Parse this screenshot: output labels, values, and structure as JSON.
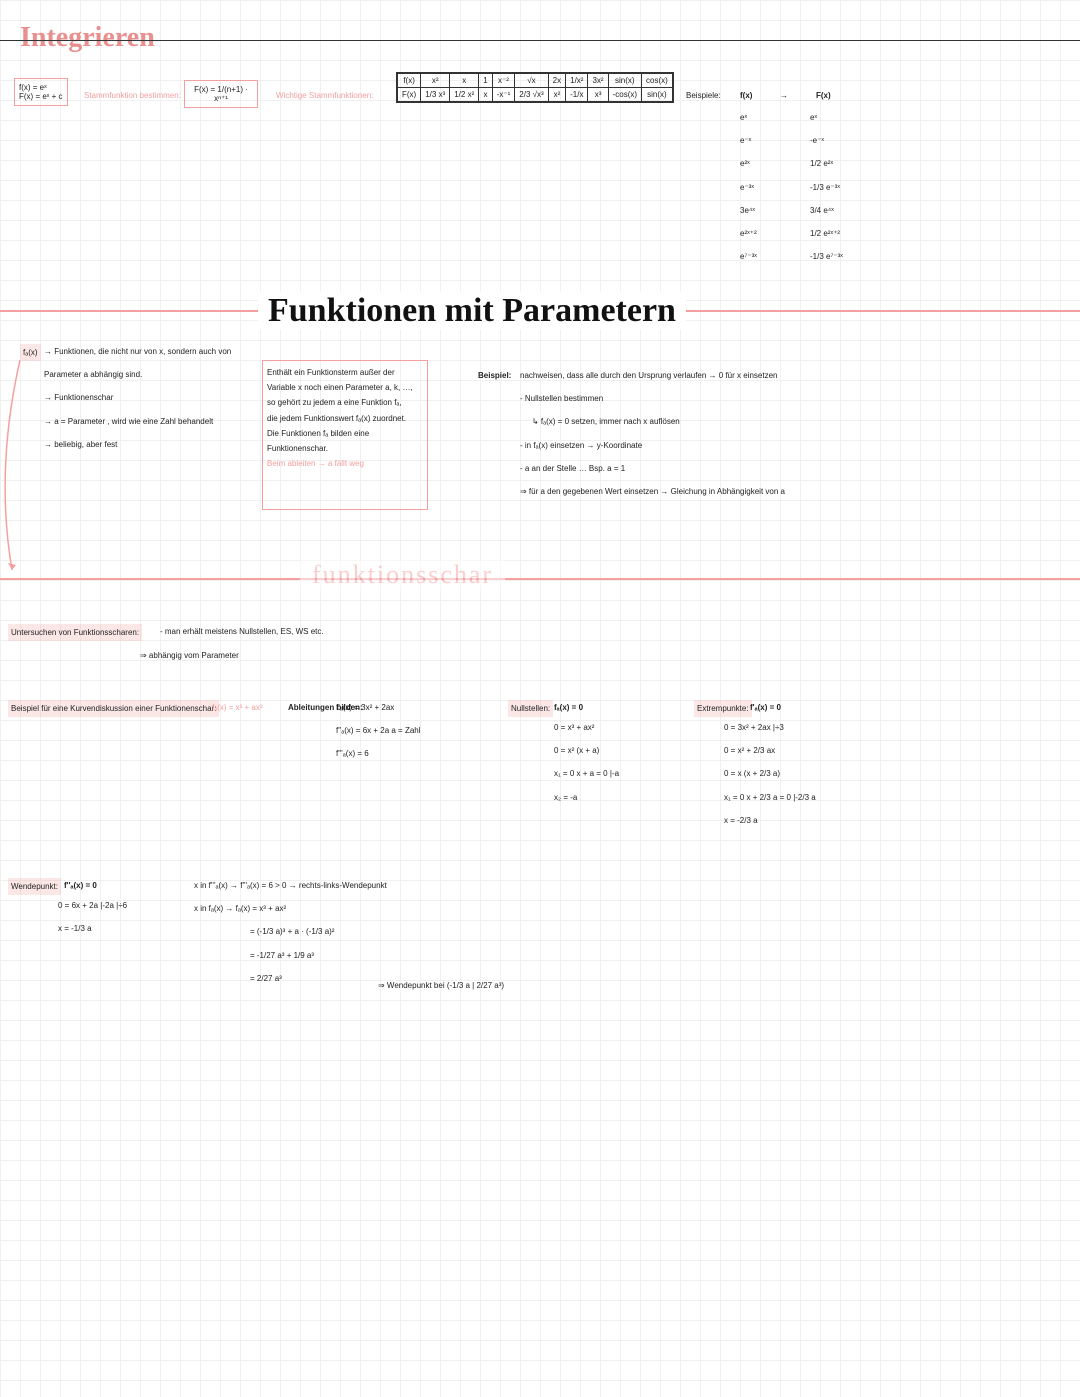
{
  "header": {
    "title": "Integrieren"
  },
  "rulebox1": {
    "l1": "f(x) = eˣ",
    "l2": "F(x) = eˣ + c"
  },
  "rulelabel1": "Stammfunktion bestimmen:",
  "rulebox2": {
    "l1": "F(x) = 1/(n+1) · xⁿ⁺¹"
  },
  "rulelabel2": "Wichtige Stammfunktionen:",
  "func_table": {
    "row1": [
      "f(x)",
      "x²",
      "x",
      "1",
      "x⁻²",
      "√x",
      "2x",
      "1/x²",
      "3x²",
      "sin(x)",
      "cos(x)"
    ],
    "row2": [
      "F(x)",
      "1/3 x³",
      "1/2 x²",
      "x",
      "-x⁻¹",
      "2/3 √x³",
      "x²",
      "-1/x",
      "x³",
      "-cos(x)",
      "sin(x)"
    ]
  },
  "beispiele": {
    "label": "Beispiele:",
    "hdr_f": "f(x)",
    "hdr_F": "F(x)",
    "arrow": "→",
    "rows": [
      {
        "f": "eˣ",
        "F": "eˣ"
      },
      {
        "f": "e⁻ˣ",
        "F": "-e⁻ˣ"
      },
      {
        "f": "e²ˣ",
        "F": "1/2 e²ˣ"
      },
      {
        "f": "e⁻³ˣ",
        "F": "-1/3 e⁻³ˣ"
      },
      {
        "f": "3e⁴ˣ",
        "F": "3/4 e⁴ˣ"
      },
      {
        "f": "e²ˣ⁺²",
        "F": "1/2 e²ˣ⁺²"
      },
      {
        "f": "e⁷⁻³ˣ",
        "F": "-1/3 e⁷⁻³ˣ"
      }
    ]
  },
  "section2": {
    "title": "Funktionen mit Parametern"
  },
  "fa_label": "fₐ(x)",
  "fa_notes": [
    "→ Funktionen, die nicht nur von x, sondern auch von",
    "Parameter a abhängig sind.",
    "→ Funktionenschar",
    "→ a = Parameter , wird wie eine Zahl behandelt",
    "→ beliebig, aber fest"
  ],
  "def_box": [
    "Enthält ein Funktionsterm außer der",
    "Variable x noch einen Parameter a, k, …,",
    "so gehört zu jedem a eine Funktion fₐ,",
    "die jedem Funktionswert fₐ(x) zuordnet.",
    "Die Funktionen fₐ bilden eine Funktionenschar.",
    "Beim ableiten → a fällt weg"
  ],
  "bsp_right": {
    "label": "Beispiel:",
    "l1": "nachweisen, dass alle durch den Ursprung verlaufen → 0 für x einsetzen",
    "l2": "- Nullstellen bestimmen",
    "l3": "↳ fₐ(x) = 0 setzen, immer nach x auflösen",
    "l4": "- in fₐ(x) einsetzen → y-Koordinate",
    "l5": "- a an der Stelle …   Bsp. a = 1",
    "l6": "⇒ für a den gegebenen Wert einsetzen → Gleichung in Abhängigkeit von a"
  },
  "section3": {
    "title": "funktionsschar",
    "title2": "FUNKTIONSSCHAR"
  },
  "untersuchen": {
    "label": "Untersuchen von Funktionsscharen:",
    "l1": "- man erhält meistens Nullstellen, ES, WS etc.",
    "l2": "⇒ abhängig vom Parameter"
  },
  "kurven": {
    "label": "Beispiel für eine Kurvendiskussion einer Funktionenschar:",
    "fx": "fₐ(x) = x³ + ax²"
  },
  "ableitungen": {
    "label": "Ableitungen bilden:",
    "l1": "f'ₐ(x) = 3x² + 2ax",
    "l2": "f''ₐ(x) = 6x + 2a    a = Zahl",
    "l3": "f'''ₐ(x) = 6"
  },
  "nullstellen": {
    "label": "Nullstellen:",
    "cond": "fₐ(x) = 0",
    "l1": "0 = x³ + ax²",
    "l2": "0 = x² (x + a)",
    "l3": "x₁ = 0     x + a = 0   |-a",
    "l4": "x₂ = -a"
  },
  "extrem": {
    "label": "Extrempunkte:",
    "cond": "f'ₐ(x) = 0",
    "l1": "0 = 3x² + 2ax   |÷3",
    "l2": "0 = x² + 2/3 ax",
    "l3": "0 = x (x + 2/3 a)",
    "l4": "x₁ = 0    x + 2/3 a = 0   |-2/3 a",
    "l5": "x = -2/3 a"
  },
  "wende": {
    "label": "Wendepunkt:",
    "cond": "f''ₐ(x) = 0",
    "l1": "0 = 6x + 2a   |-2a   |÷6",
    "l2": "x = -1/3 a"
  },
  "wende_r": {
    "l1": "x in f'''ₐ(x) → f'''ₐ(x) = 6 > 0 → rechts-links-Wendepunkt",
    "l2": "x in fₐ(x) → fₐ(x) = x³ + ax²",
    "l3": "= (-1/3 a)³ + a · (-1/3 a)²",
    "l4": "= -1/27 a³ + 1/9 a³",
    "l5": "= 2/27 a³",
    "l6": "⇒ Wendepunkt bei (-1/3 a | 2/27 a³)"
  }
}
